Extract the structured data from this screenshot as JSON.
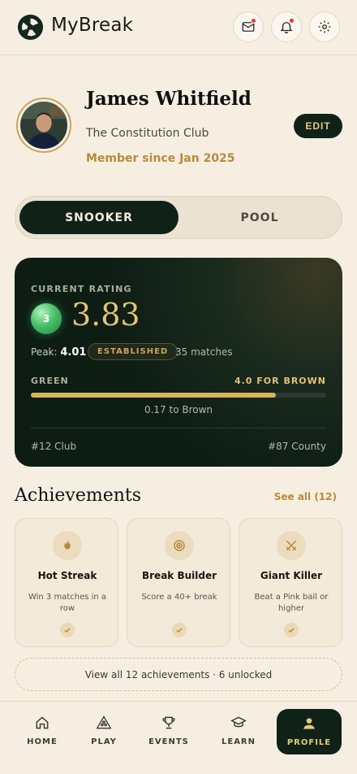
{
  "app": {
    "title": "MyBreak"
  },
  "header": {
    "icons": [
      "mail-icon",
      "bell-icon",
      "gear-icon"
    ]
  },
  "profile": {
    "name": "James Whitfield",
    "club": "The Constitution Club",
    "member_since": "Member since Jan 2025",
    "edit_label": "EDIT"
  },
  "toggle": {
    "options": [
      "SNOOKER",
      "POOL"
    ],
    "selected": "SNOOKER"
  },
  "rating_card": {
    "label": "CURRENT RATING",
    "ball_number": "3",
    "rating": "3.83",
    "peak_label": "Peak:",
    "peak_value": "4.01",
    "status_badge": "ESTABLISHED",
    "matches": "35 matches",
    "tier": "GREEN",
    "next_tier": "4.0 FOR BROWN",
    "progress": 0.83,
    "to_next": "0.17 to Brown",
    "club_rank": "#12 Club",
    "county_rank": "#87 County"
  },
  "achievements": {
    "title": "Achievements",
    "see_all": "See all (12)",
    "items": [
      {
        "name": "Hot Streak",
        "desc": "Win 3 matches in a row",
        "icon": "flame-icon"
      },
      {
        "name": "Break Builder",
        "desc": "Score a 40+ break",
        "icon": "target-icon"
      },
      {
        "name": "Giant Killer",
        "desc": "Beat a Pink ball or higher",
        "icon": "swords-icon"
      }
    ],
    "view_all": "View all 12 achievements · 6 unlocked"
  },
  "nav": {
    "items": [
      {
        "label": "HOME",
        "icon": "home-icon"
      },
      {
        "label": "PLAY",
        "icon": "triangle-rack-icon"
      },
      {
        "label": "EVENTS",
        "icon": "trophy-icon"
      },
      {
        "label": "LEARN",
        "icon": "graduation-cap-icon"
      },
      {
        "label": "PROFILE",
        "icon": "user-icon"
      }
    ],
    "active": "PROFILE"
  },
  "colors": {
    "background": "#f6efe1",
    "dark_green": "#102218",
    "gold": "#e5c275",
    "accent_brown": "#b98a3a",
    "notification_dot": "#d9402f"
  }
}
